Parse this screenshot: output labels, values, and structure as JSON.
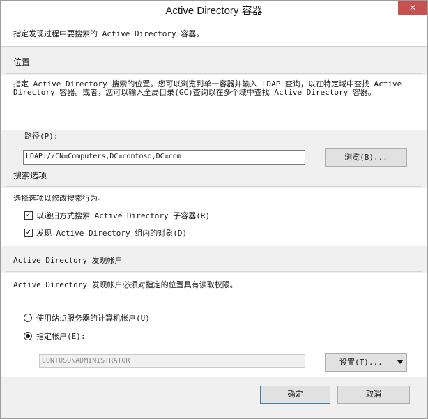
{
  "window": {
    "title": "Active Directory 容器",
    "close_glyph": "✕"
  },
  "header": {
    "description": "指定发现过程中要搜索的 Active Directory 容器。"
  },
  "location": {
    "heading": "位置",
    "description_line1": "指定 Active Directory 搜索的位置。您可以浏览到单一容器并输入 LDAP 查询，以在特定域中查找 Active",
    "description_line2": "Directory 容器。或者，您可以输入全局目录(GC)查询以在多个域中查找 Active Directory 容器。",
    "path_label": "路径(P):",
    "path_value": "LDAP://CN=Computers,DC=contoso,DC=com",
    "browse_label": "浏览(B)..."
  },
  "search_options": {
    "heading": "搜索选项",
    "description": "选择选项以修改搜索行为。",
    "recursive_label": "以递归方式搜索 Active Directory 子容器(R)",
    "recursive_checked": true,
    "groups_label": "发现 Active Directory 组内的对象(D)",
    "groups_checked": true,
    "check_glyph": "✓"
  },
  "account": {
    "heading": "Active Directory 发现帐户",
    "description": "Active Directory 发现帐户必须对指定的位置具有读取权限。",
    "site_server_label": "使用站点服务器的计算机帐户(U)",
    "site_server_selected": false,
    "specify_label": "指定帐户(E):",
    "specify_selected": true,
    "account_value": "CONTOSO\\ADMINISTRATOR",
    "settings_label": "设置(T)..."
  },
  "footer": {
    "ok_label": "确定",
    "cancel_label": "取消"
  }
}
